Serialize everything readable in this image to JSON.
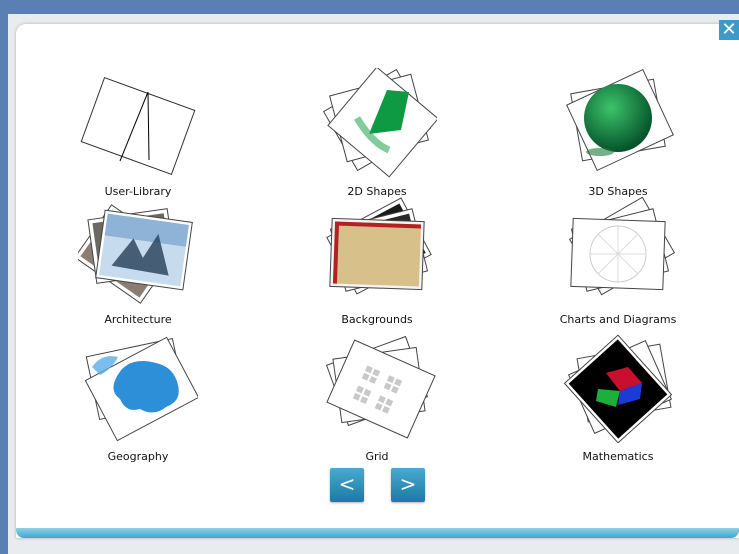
{
  "categories": [
    {
      "label": "User-Library"
    },
    {
      "label": "2D Shapes"
    },
    {
      "label": "3D Shapes"
    },
    {
      "label": "Architecture"
    },
    {
      "label": "Backgrounds"
    },
    {
      "label": "Charts and Diagrams"
    },
    {
      "label": "Geography"
    },
    {
      "label": "Grid"
    },
    {
      "label": "Mathematics"
    }
  ],
  "nav": {
    "prev": "<",
    "next": ">"
  },
  "close": "✕",
  "colors": {
    "accent": "#3d9ac8",
    "shape_green": "#0e9a43",
    "geo_blue": "#2d8fd8"
  }
}
